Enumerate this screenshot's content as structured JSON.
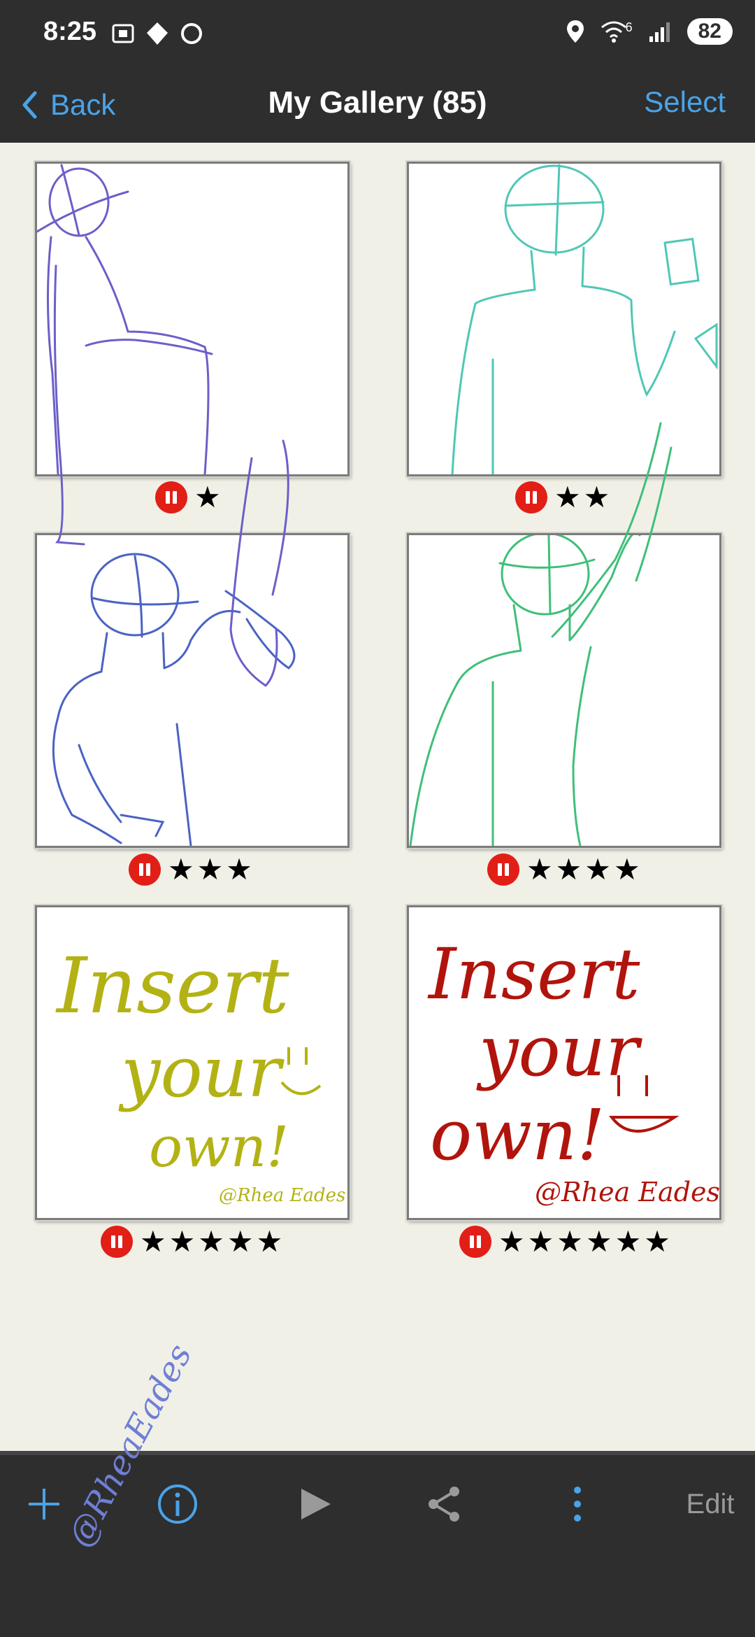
{
  "status_bar": {
    "time": "8:25",
    "battery": "82",
    "network_tag": "6"
  },
  "nav": {
    "back_label": "Back",
    "title": "My Gallery (85)",
    "select_label": "Select"
  },
  "gallery": {
    "items": [
      {
        "stars": "★",
        "rating": 1,
        "drawing": "sitting figure sketch",
        "color": "#6b5fc9"
      },
      {
        "stars": "★★",
        "rating": 2,
        "drawing": "standing figure holding card",
        "color": "#4fc7b6"
      },
      {
        "stars": "★★★",
        "rating": 3,
        "drawing": "figure hand on hip",
        "color": "#4a63c4"
      },
      {
        "stars": "★★★★",
        "rating": 4,
        "drawing": "figure reaching up",
        "color": "#3fbf7a"
      },
      {
        "stars": "★★★★★",
        "rating": 5,
        "text": "Insert your own!",
        "signature": "@Rhea Eades",
        "color": "#b3b214"
      },
      {
        "stars": "★★★★★★",
        "rating": 6,
        "text": "Insert your own!",
        "signature": "@Rhea Eades",
        "color": "#b1140c"
      }
    ],
    "overlay_signature": "@RheaEades"
  },
  "toolbar": {
    "add_icon": "plus-icon",
    "info_icon": "info-icon",
    "play_icon": "play-icon",
    "share_icon": "share-icon",
    "more_icon": "more-vertical-icon",
    "edit_label": "Edit"
  },
  "colors": {
    "accent": "#4aa3e8",
    "bar": "#2e2e2e",
    "background": "#f1f0e7",
    "badge": "#e11f17"
  }
}
